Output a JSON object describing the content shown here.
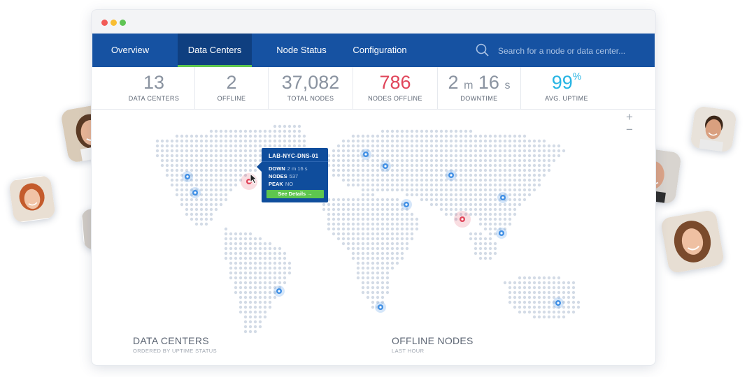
{
  "tabs": [
    {
      "label": "Overview",
      "active": false
    },
    {
      "label": "Data Centers",
      "active": true
    },
    {
      "label": "Node Status",
      "active": false
    },
    {
      "label": "Configuration",
      "active": false
    }
  ],
  "search": {
    "placeholder": "Search for a node or data center..."
  },
  "stats": {
    "data_centers": {
      "value": "13",
      "label": "DATA CENTERS"
    },
    "offline": {
      "value": "2",
      "label": "OFFLINE"
    },
    "total_nodes": {
      "value": "37,082",
      "label": "TOTAL NODES"
    },
    "nodes_offline": {
      "value": "786",
      "label": "NODES OFFLINE"
    },
    "downtime": {
      "minutes": "2",
      "minutes_unit": "m",
      "seconds": "16",
      "seconds_unit": "s",
      "label": "DOWNTIME"
    },
    "avg_uptime": {
      "value": "99",
      "unit": "%",
      "label": "AVG. UPTIME"
    }
  },
  "map": {
    "zoom_in": "+",
    "zoom_out": "−",
    "online_color": "#3f8fe5",
    "offline_color": "#e0455a"
  },
  "tooltip": {
    "title": "LAB-NYC-DNS-01",
    "rows": [
      {
        "key": "DOWN",
        "value": "2 m 16 s"
      },
      {
        "key": "NODES",
        "value": "537"
      },
      {
        "key": "PEAK",
        "value": "NO"
      }
    ],
    "button": "See Details →"
  },
  "sections": {
    "data_centers": {
      "title": "DATA CENTERS",
      "subtitle": "ORDERED BY UPTIME STATUS"
    },
    "offline_nodes": {
      "title": "OFFLINE NODES",
      "subtitle": "LAST HOUR"
    }
  },
  "colors": {
    "nav": "#1652a2",
    "nav_active": "#0f3f80",
    "accent": "#5ec64e",
    "red_stat": "#e0455a",
    "cyan_stat": "#27b4e3"
  }
}
